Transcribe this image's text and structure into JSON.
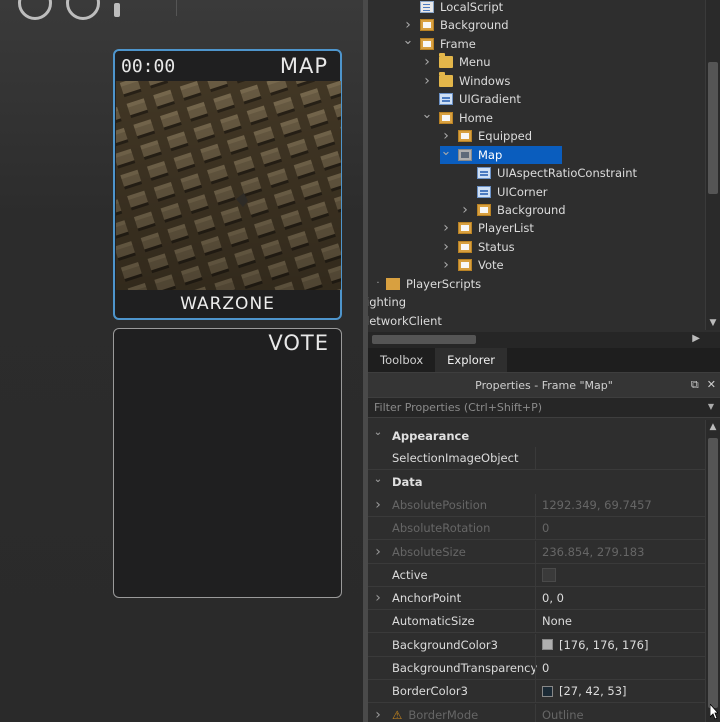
{
  "viewport": {
    "map_card": {
      "timer": "00:00",
      "label": "MAP",
      "map_name": "WARZONE"
    },
    "vote_card": {
      "label": "VOTE"
    }
  },
  "explorer": {
    "items": [
      {
        "label": "LocalScript",
        "icon": "script-icon",
        "depth": 0,
        "chevron": "none"
      },
      {
        "label": "Background",
        "icon": "frame-icon",
        "depth": 0,
        "chevron": "right"
      },
      {
        "label": "Frame",
        "icon": "frame-icon",
        "depth": 0,
        "chevron": "down"
      },
      {
        "label": "Menu",
        "icon": "folder-icon",
        "depth": 1,
        "chevron": "right"
      },
      {
        "label": "Windows",
        "icon": "folder-icon",
        "depth": 1,
        "chevron": "right"
      },
      {
        "label": "UIGradient",
        "icon": "ui-object-icon",
        "depth": 1,
        "chevron": "none"
      },
      {
        "label": "Home",
        "icon": "frame-icon",
        "depth": 1,
        "chevron": "down"
      },
      {
        "label": "Equipped",
        "icon": "frame-icon",
        "depth": 2,
        "chevron": "right"
      },
      {
        "label": "Map",
        "icon": "frame-icon",
        "depth": 2,
        "chevron": "down",
        "selected": true
      },
      {
        "label": "UIAspectRatioConstraint",
        "icon": "ui-object-icon",
        "depth": 3,
        "chevron": "none"
      },
      {
        "label": "UICorner",
        "icon": "ui-object-icon",
        "depth": 3,
        "chevron": "none"
      },
      {
        "label": "Background",
        "icon": "frame-icon",
        "depth": 3,
        "chevron": "right"
      },
      {
        "label": "PlayerList",
        "icon": "frame-icon",
        "depth": 2,
        "chevron": "right"
      },
      {
        "label": "Status",
        "icon": "frame-icon",
        "depth": 2,
        "chevron": "right"
      },
      {
        "label": "Vote",
        "icon": "frame-icon",
        "depth": 2,
        "chevron": "right"
      },
      {
        "label": "PlayerScripts",
        "icon": "player-scripts-icon",
        "depth": -1,
        "chevron": "none"
      },
      {
        "label": "ighting",
        "icon": "none",
        "depth": -2,
        "chevron": "none"
      },
      {
        "label": "letworkClient",
        "icon": "none",
        "depth": -2,
        "chevron": "none"
      }
    ]
  },
  "tabs": [
    {
      "label": "Toolbox",
      "active": false
    },
    {
      "label": "Explorer",
      "active": true
    }
  ],
  "properties": {
    "title": "Properties - Frame \"Map\"",
    "filter_placeholder": "Filter Properties (Ctrl+Shift+P)",
    "rows": [
      {
        "type": "section",
        "name": "Appearance"
      },
      {
        "type": "prop",
        "name": "SelectionImageObject",
        "value": ""
      },
      {
        "type": "section",
        "name": "Data"
      },
      {
        "type": "prop",
        "name": "AbsolutePosition",
        "value": "1292.349, 69.7457",
        "dim": true,
        "expandable": true
      },
      {
        "type": "prop",
        "name": "AbsoluteRotation",
        "value": "0",
        "dim": true
      },
      {
        "type": "prop",
        "name": "AbsoluteSize",
        "value": "236.854, 279.183",
        "dim": true,
        "expandable": true
      },
      {
        "type": "prop",
        "name": "Active",
        "value": "",
        "checkbox": true
      },
      {
        "type": "prop",
        "name": "AnchorPoint",
        "value": "0, 0",
        "expandable": true
      },
      {
        "type": "prop",
        "name": "AutomaticSize",
        "value": "None"
      },
      {
        "type": "prop",
        "name": "BackgroundColor3",
        "value": "[176, 176, 176]",
        "swatch": "#b0b0b0"
      },
      {
        "type": "prop",
        "name": "BackgroundTransparency",
        "value": "0"
      },
      {
        "type": "prop",
        "name": "BorderColor3",
        "value": "[27, 42, 53]",
        "swatch": "#1b2a35"
      },
      {
        "type": "prop",
        "name": "BorderMode",
        "value": "Outline",
        "dim": true,
        "expandable": true,
        "warning": true
      }
    ]
  },
  "colors": {
    "selection": "#0a5dbe",
    "map_card_border": "#4e95cc"
  }
}
